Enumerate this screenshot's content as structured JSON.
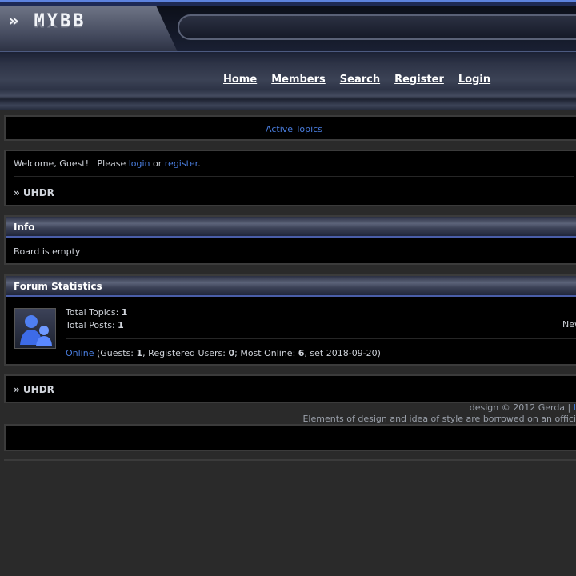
{
  "header": {
    "logo": "» MYBB",
    "nav": [
      "Home",
      "Members",
      "Search",
      "Register",
      "Login"
    ]
  },
  "topbar": {
    "active_topics": "Active Topics"
  },
  "welcome": {
    "prefix": "Welcome, Guest!   Please ",
    "login": "login",
    "or": " or ",
    "register": "register",
    "suffix": ".",
    "breadcrumb": "» UHDR"
  },
  "info": {
    "title": "Info",
    "body": "Board is empty"
  },
  "stats": {
    "title": "Forum Statistics",
    "topics_label": "Total Topics: ",
    "topics": "1",
    "posts_label": "Total Posts: ",
    "posts": "1",
    "newest": "New",
    "online_link": "Online",
    "guests_label": " (Guests: ",
    "guests": "1",
    "reg_label": ", Registered Users: ",
    "reg": "0",
    "most_label": "; Most Online: ",
    "most": "6",
    "date": ", set 2018-09-20)"
  },
  "bottom": {
    "breadcrumb": "» UHDR"
  },
  "footer": {
    "line1": "design © 2012 Gerda | ",
    "line1_link": "I",
    "line2": "Elements of design and idea of style are borrowed on an offici"
  }
}
